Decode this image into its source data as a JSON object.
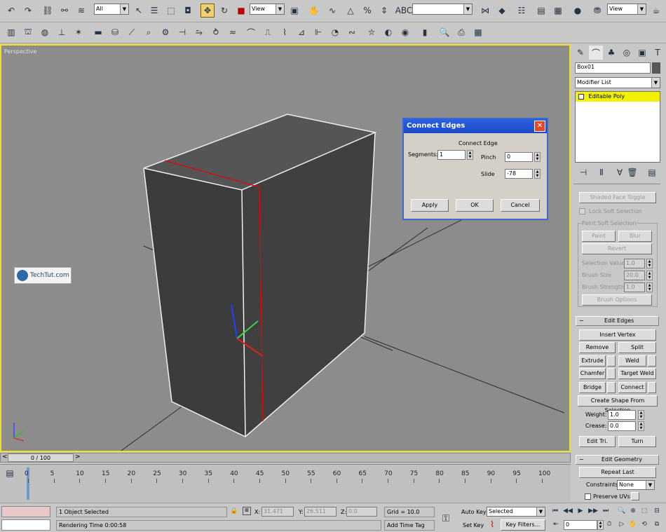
{
  "toolbar": {
    "selection_filter": "All",
    "ref_coord": "View",
    "named_selection": "",
    "view_right": "View"
  },
  "viewport": {
    "label": "Perspective",
    "watermark": "TechTut.com"
  },
  "dialog": {
    "title": "Connect Edges",
    "group": "Connect Edge",
    "segments_label": "Segments:",
    "segments_value": "1",
    "pinch_label": "Pinch",
    "pinch_value": "0",
    "slide_label": "Slide",
    "slide_value": "-78",
    "apply": "Apply",
    "ok": "OK",
    "cancel": "Cancel"
  },
  "panel": {
    "object_name": "Box01",
    "modifier_list": "Modifier List",
    "stack_item": "Editable Poly",
    "shaded_face_toggle": "Shaded Face Toggle",
    "lock_soft_selection": "Lock Soft Selection",
    "paint_soft_selection": "Paint Soft Selection",
    "paint": "Paint",
    "blur": "Blur",
    "revert": "Revert",
    "selection_value_label": "Selection Value",
    "selection_value": "1.0",
    "brush_size_label": "Brush Size",
    "brush_size": "20.0",
    "brush_strength_label": "Brush Strength",
    "brush_strength": "1.0",
    "brush_options": "Brush Options",
    "edit_edges_title": "Edit Edges",
    "insert_vertex": "Insert Vertex",
    "remove": "Remove",
    "split": "Split",
    "extrude": "Extrude",
    "weld": "Weld",
    "chamfer": "Chamfer",
    "target_weld": "Target Weld",
    "bridge": "Bridge",
    "connect": "Connect",
    "create_shape": "Create Shape From Selection",
    "weight_label": "Weight:",
    "weight_value": "1.0",
    "crease_label": "Crease:",
    "crease_value": "0.0",
    "edit_tri": "Edit Tri.",
    "turn": "Turn",
    "edit_geometry_title": "Edit Geometry",
    "repeat_last": "Repeat Last",
    "constraints_label": "Constraints:",
    "constraints_value": "None",
    "preserve_uvs": "Preserve UVs"
  },
  "timeline": {
    "slider_label": "0 / 100",
    "ticks": [
      "0",
      "5",
      "10",
      "15",
      "20",
      "25",
      "30",
      "35",
      "40",
      "45",
      "50",
      "55",
      "60",
      "65",
      "70",
      "75",
      "80",
      "85",
      "90",
      "95",
      "100"
    ]
  },
  "status": {
    "selected_text": "1 Object Selected",
    "rendering_time": "Rendering Time  0:00:58",
    "x_label": "X:",
    "x_value": "31.471",
    "y_label": "Y:",
    "y_value": "26.511",
    "z_label": "Z:",
    "z_value": "0.0",
    "grid": "Grid = 10.0",
    "add_time_tag": "Add Time Tag",
    "auto_key": "Auto Key",
    "set_key": "Set Key",
    "key_mode": "Selected",
    "key_filters": "Key Filters...",
    "frame": "0"
  }
}
